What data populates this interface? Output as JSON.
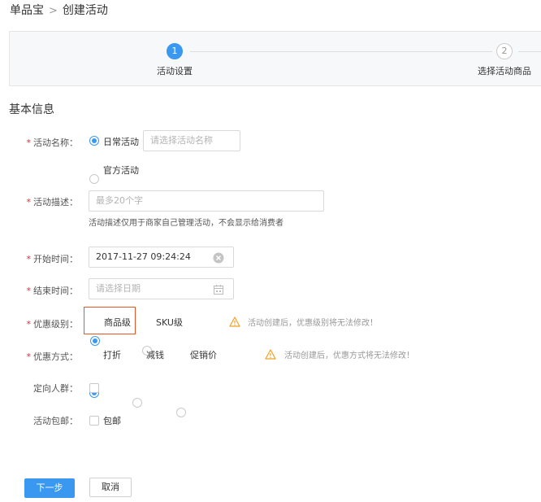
{
  "breadcrumb": {
    "parent": "单品宝",
    "separator": ">",
    "current": "创建活动"
  },
  "steps": [
    {
      "number": "1",
      "label": "活动设置",
      "state": "active"
    },
    {
      "number": "2",
      "label": "选择活动商品",
      "state": "inactive"
    }
  ],
  "section_title": "基本信息",
  "required_mark": "*",
  "form": {
    "activity_name": {
      "label": "活动名称：",
      "options": [
        "日常活动",
        "官方活动"
      ],
      "selected": "日常活动",
      "placeholder": "请选择活动名称"
    },
    "activity_desc": {
      "label": "活动描述：",
      "placeholder": "最多20个字",
      "hint": "活动描述仅用于商家自己管理活动，不会显示给消费者"
    },
    "start_time": {
      "label": "开始时间：",
      "value": "2017-11-27 09:24:24"
    },
    "end_time": {
      "label": "结束时间：",
      "placeholder": "请选择日期"
    },
    "discount_level": {
      "label": "优惠级别：",
      "options": [
        "商品级",
        "SKU级"
      ],
      "selected": "商品级",
      "warning": "活动创建后，优惠级别将无法修改！"
    },
    "discount_type": {
      "label": "优惠方式：",
      "options": [
        "打折",
        "减钱",
        "促销价"
      ],
      "selected": "打折",
      "warning": "活动创建后，优惠方式将无法修改！"
    },
    "target_group": {
      "label": "定向人群：",
      "checked": false
    },
    "free_shipping": {
      "label": "活动包邮：",
      "option": "包邮",
      "checked": false
    }
  },
  "buttons": {
    "next": "下一步",
    "cancel": "取消"
  },
  "colors": {
    "primary": "#3a98f1",
    "required": "#f5222d",
    "warning": "#f0a020",
    "highlight": "#e8552a"
  },
  "icons": {
    "clear": "clear-icon",
    "calendar": "calendar-icon",
    "warning": "warning-triangle-icon"
  }
}
